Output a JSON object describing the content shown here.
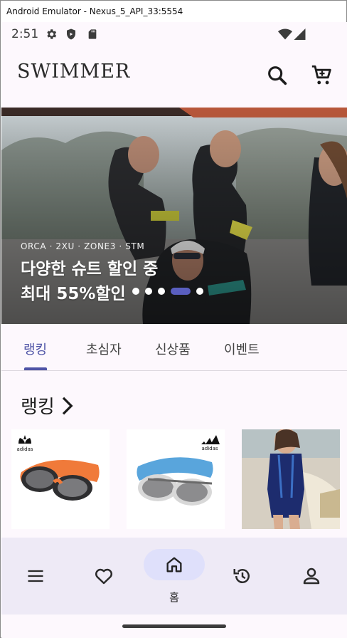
{
  "window": {
    "title": "Android Emulator - Nexus_5_API_33:5554"
  },
  "status_bar": {
    "time": "2:51",
    "icons": [
      "settings-gear-icon",
      "shield-icon",
      "sd-card-icon",
      "wifi-icon",
      "signal-icon"
    ]
  },
  "app_bar": {
    "logo": "SWIMMER",
    "icons": [
      "search-icon",
      "cart-icon"
    ]
  },
  "banner": {
    "brands": "ORCA · 2XU · ZONE3 · STM",
    "title_line1": "다양한 슈트 할인 중",
    "title_line2": "최대 55%할인",
    "page_count": 5,
    "active_page": 4
  },
  "tabs": [
    {
      "label": "랭킹",
      "active": true
    },
    {
      "label": "초심자",
      "active": false
    },
    {
      "label": "신상품",
      "active": false
    },
    {
      "label": "이벤트",
      "active": false
    }
  ],
  "section": {
    "title": "랭킹"
  },
  "products": [
    {
      "brand_logo": "adidas",
      "image": "orange-goggles"
    },
    {
      "brand_logo": "adidas",
      "image": "blue-goggles"
    },
    {
      "brand_logo": "",
      "image": "navy-swimsuit"
    }
  ],
  "bottom_nav": {
    "items": [
      {
        "icon": "menu-icon"
      },
      {
        "icon": "heart-icon"
      },
      {
        "icon": "home-icon",
        "label": "홈",
        "active": true
      },
      {
        "icon": "history-icon"
      },
      {
        "icon": "person-icon"
      }
    ]
  },
  "colors": {
    "accent": "#4e53a6",
    "active_pill": "#dfe0fb",
    "nav_bg": "#eeeaf6",
    "screen_bg": "#fdf8fd"
  }
}
